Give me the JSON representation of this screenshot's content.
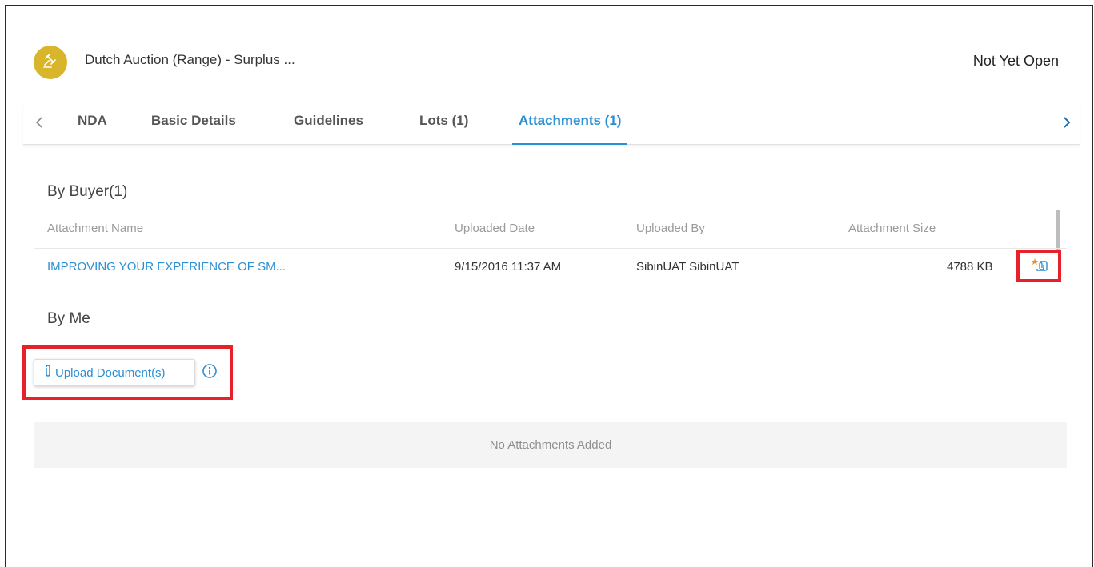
{
  "header": {
    "title": "Dutch Auction (Range) - Surplus ...",
    "status": "Not Yet Open",
    "avatar_icon": "gavel-icon",
    "avatar_color": "#d9b52b"
  },
  "tabs": [
    {
      "label": "NDA",
      "active": false
    },
    {
      "label": "Basic Details",
      "active": false
    },
    {
      "label": "Guidelines",
      "active": false
    },
    {
      "label": "Lots (1)",
      "active": false
    },
    {
      "label": "Attachments (1)",
      "active": true
    }
  ],
  "colors": {
    "accent": "#2a8fd3",
    "highlight": "#e8202a"
  },
  "by_buyer": {
    "title": "By Buyer(1)",
    "columns": [
      "Attachment Name",
      "Uploaded Date",
      "Uploaded By",
      "Attachment Size"
    ],
    "rows": [
      {
        "name": "IMPROVING YOUR EXPERIENCE OF SM...",
        "date": "9/15/2016 11:37 AM",
        "by": "SibinUAT SibinUAT",
        "size": "4788 KB",
        "action_icon": "attachment-action-icon"
      }
    ]
  },
  "by_me": {
    "title": "By Me",
    "upload_label": "Upload Document(s)",
    "upload_icon": "paperclip-icon",
    "info_icon": "info-icon",
    "empty_text": "No Attachments Added"
  }
}
